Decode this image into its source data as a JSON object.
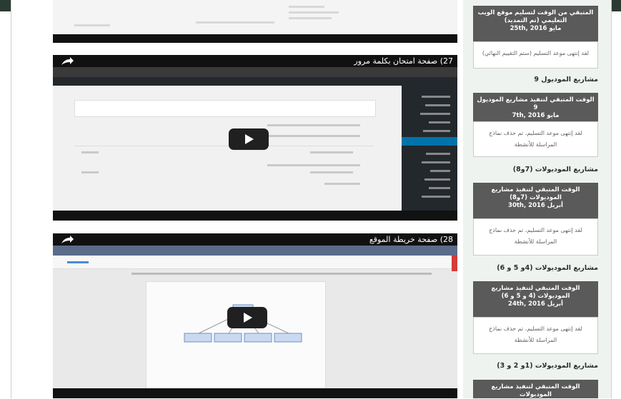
{
  "videos": [
    {
      "title": "27) صفحة امتحان بكلمة مرور"
    },
    {
      "title": "28) صفحة خريطة الموقع"
    }
  ],
  "sidebar": {
    "card1": {
      "title": "المتبقي من الوقت لتسليم موقع الويب التعليمي (تم التمديد)",
      "date": "مايو 25th, 2016",
      "body": "لقد إنتهى موعد التسليم (ستم التقييم النهائي)"
    },
    "section1": "مشاريع الموديول 9",
    "card2": {
      "title": "الوقت المتبقي لتنفيذ مشاريع الموديول 9",
      "date": "مايو 7th, 2016",
      "body": "لقد إنتهى موعد التسليم، تم حذف نماذج المراسلة للأنشطة"
    },
    "section2": "مشاريع الموديولات (7و8)",
    "card3": {
      "title": "الوقت المتبقي لتنفيذ مشاريع الموديولات (7و8)",
      "date": "أبريل 30th, 2016",
      "body": "لقد إنتهى موعد التسليم، تم حذف نماذج المراسلة للأنشطة"
    },
    "section3": "مشاريع الموديولات (4و 5 و 6)",
    "card4": {
      "title": "الوقت المتبقي لتنفيذ مشاريع الموديولات (4 و 5 و 6)",
      "date": "أبريل 24th, 2016",
      "body": "لقد إنتهى موعد التسليم، تم حذف نماذج المراسلة للأنشطة"
    },
    "section4": "مشاريع الموديولات (1و 2 و 3)",
    "card5": {
      "title": "الوقت المتبقي لتنفيذ مشاريع الموديولات"
    }
  },
  "colors": {
    "topbar": "#2b3b33",
    "card_head": "#5a5a5a",
    "sidebar_bg": "#eef3ef",
    "video_bg": "#0f0f0f"
  }
}
